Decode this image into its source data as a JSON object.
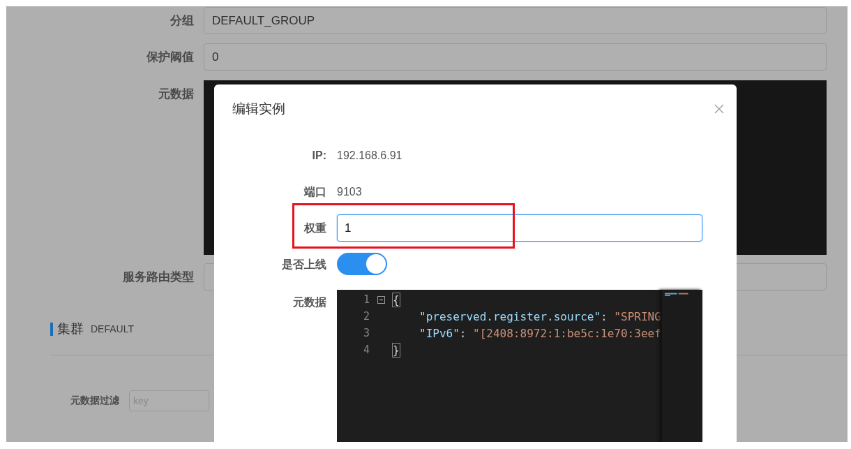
{
  "background_form": {
    "fields": [
      {
        "label": "分组",
        "kind": "text",
        "value": "DEFAULT_GROUP"
      },
      {
        "label": "保护阈值",
        "kind": "text",
        "value": "0"
      },
      {
        "label": "元数据",
        "kind": "editor"
      },
      {
        "label": "服务路由类型",
        "kind": "text"
      }
    ],
    "cluster": {
      "title": "集群",
      "name": "DEFAULT"
    },
    "filter": {
      "label": "元数据过滤",
      "placeholder": "key"
    }
  },
  "dialog": {
    "title": "编辑实例",
    "fields": [
      {
        "label": "IP:",
        "kind": "static",
        "value": "192.168.6.91"
      },
      {
        "label": "端口",
        "kind": "static",
        "value": "9103"
      },
      {
        "label": "权重",
        "kind": "input",
        "value": "1",
        "focused": true,
        "highlighted": true
      },
      {
        "label": "是否上线",
        "kind": "switch",
        "on": true
      },
      {
        "label": "元数据",
        "kind": "editor",
        "lines": [
          {
            "number": "1",
            "foldable": true,
            "indent": false,
            "tokens": [
              {
                "kind": "bracket",
                "text": "{",
                "matched": true
              }
            ]
          },
          {
            "number": "2",
            "foldable": false,
            "indent": true,
            "tokens": [
              {
                "kind": "key",
                "text": "\"preserved.register.source\""
              },
              {
                "kind": "punct",
                "text": ": "
              },
              {
                "kind": "string",
                "text": "\"SPRING"
              }
            ]
          },
          {
            "number": "3",
            "foldable": false,
            "indent": true,
            "tokens": [
              {
                "kind": "key",
                "text": "\"IPv6\""
              },
              {
                "kind": "punct",
                "text": ": "
              },
              {
                "kind": "string",
                "text": "\"[2408:8972:1:be5c:1e70:3eef"
              }
            ]
          },
          {
            "number": "4",
            "foldable": false,
            "indent": false,
            "tokens": [
              {
                "kind": "bracket",
                "text": "}",
                "matched": true
              }
            ]
          }
        ]
      }
    ]
  }
}
